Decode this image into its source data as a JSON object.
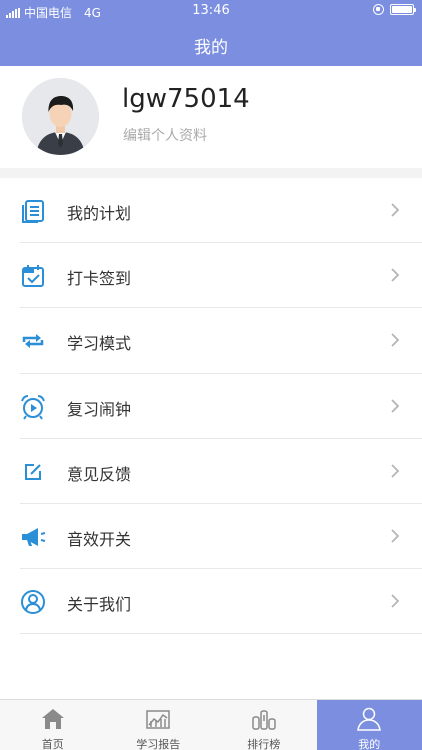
{
  "status_bar": {
    "carrier": "中国电信",
    "network": "4G",
    "time": "13:46"
  },
  "nav": {
    "title": "我的"
  },
  "profile": {
    "username": "lgw75014",
    "edit_label": "编辑个人资料"
  },
  "menu": [
    {
      "label": "我的计划",
      "icon": "plan-list-icon"
    },
    {
      "label": "打卡签到",
      "icon": "calendar-check-icon"
    },
    {
      "label": "学习模式",
      "icon": "repeat-icon"
    },
    {
      "label": "复习闹钟",
      "icon": "alarm-clock-icon"
    },
    {
      "label": "意见反馈",
      "icon": "edit-feedback-icon"
    },
    {
      "label": "音效开关",
      "icon": "megaphone-icon"
    },
    {
      "label": "关于我们",
      "icon": "user-circle-icon"
    }
  ],
  "tabs": [
    {
      "label": "首页",
      "icon": "home-icon"
    },
    {
      "label": "学习报告",
      "icon": "report-chart-icon"
    },
    {
      "label": "排行榜",
      "icon": "ranking-icon"
    },
    {
      "label": "我的",
      "icon": "person-icon",
      "active": true
    }
  ],
  "colors": {
    "header": "#7b8ee0",
    "menu_icon": "#2a8fd6",
    "tab_active": "#7b8ee0"
  }
}
